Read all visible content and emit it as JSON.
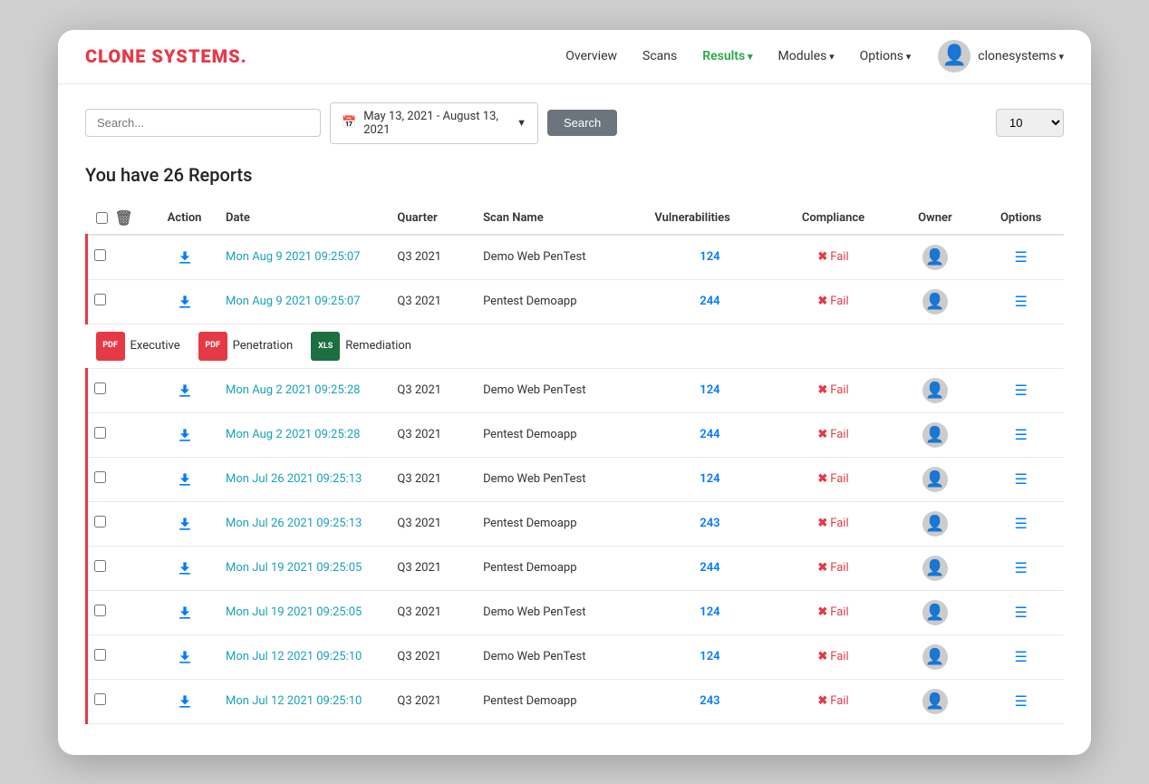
{
  "logo": {
    "text_before": "CLO",
    "highlight": "N",
    "text_after": "E SYSTEMS."
  },
  "nav": {
    "links": [
      {
        "label": "Overview",
        "active": false,
        "dropdown": false
      },
      {
        "label": "Scans",
        "active": false,
        "dropdown": false
      },
      {
        "label": "Results",
        "active": true,
        "dropdown": true
      },
      {
        "label": "Modules",
        "active": false,
        "dropdown": true
      },
      {
        "label": "Options",
        "active": false,
        "dropdown": true
      }
    ],
    "username": "clonesystems"
  },
  "search": {
    "placeholder": "Search...",
    "date_range": "May 13, 2021 - August 13, 2021",
    "search_btn": "Search",
    "per_page": "10"
  },
  "reports": {
    "count_text": "You have 26 Reports",
    "columns": [
      "Action",
      "Date",
      "Quarter",
      "Scan Name",
      "Vulnerabilities",
      "Compliance",
      "Owner",
      "Options"
    ]
  },
  "report_types": [
    {
      "type": "pdf",
      "label": "Executive"
    },
    {
      "type": "pdf",
      "label": "Penetration"
    },
    {
      "type": "xls",
      "label": "Remediation"
    }
  ],
  "rows": [
    {
      "id": 1,
      "date": "Mon Aug 9 2021 09:25:07",
      "quarter": "Q3 2021",
      "scan_name": "Demo Web PenTest",
      "vulnerabilities": 124,
      "compliance": "Fail",
      "show_report_types": false,
      "group": 1
    },
    {
      "id": 2,
      "date": "Mon Aug 9 2021 09:25:07",
      "quarter": "Q3 2021",
      "scan_name": "Pentest Demoapp",
      "vulnerabilities": 244,
      "compliance": "Fail",
      "show_report_types": true,
      "group": 1
    },
    {
      "id": 3,
      "date": "Mon Aug 2 2021 09:25:28",
      "quarter": "Q3 2021",
      "scan_name": "Demo Web PenTest",
      "vulnerabilities": 124,
      "compliance": "Fail",
      "show_report_types": false,
      "group": 2
    },
    {
      "id": 4,
      "date": "Mon Aug 2 2021 09:25:28",
      "quarter": "Q3 2021",
      "scan_name": "Pentest Demoapp",
      "vulnerabilities": 244,
      "compliance": "Fail",
      "show_report_types": false,
      "group": 2
    },
    {
      "id": 5,
      "date": "Mon Jul 26 2021 09:25:13",
      "quarter": "Q3 2021",
      "scan_name": "Demo Web PenTest",
      "vulnerabilities": 124,
      "compliance": "Fail",
      "show_report_types": false,
      "group": 3
    },
    {
      "id": 6,
      "date": "Mon Jul 26 2021 09:25:13",
      "quarter": "Q3 2021",
      "scan_name": "Pentest Demoapp",
      "vulnerabilities": 243,
      "compliance": "Fail",
      "show_report_types": false,
      "group": 3
    },
    {
      "id": 7,
      "date": "Mon Jul 19 2021 09:25:05",
      "quarter": "Q3 2021",
      "scan_name": "Pentest Demoapp",
      "vulnerabilities": 244,
      "compliance": "Fail",
      "show_report_types": false,
      "group": 4
    },
    {
      "id": 8,
      "date": "Mon Jul 19 2021 09:25:05",
      "quarter": "Q3 2021",
      "scan_name": "Demo Web PenTest",
      "vulnerabilities": 124,
      "compliance": "Fail",
      "show_report_types": false,
      "group": 4
    },
    {
      "id": 9,
      "date": "Mon Jul 12 2021 09:25:10",
      "quarter": "Q3 2021",
      "scan_name": "Demo Web PenTest",
      "vulnerabilities": 124,
      "compliance": "Fail",
      "show_report_types": false,
      "group": 5
    },
    {
      "id": 10,
      "date": "Mon Jul 12 2021 09:25:10",
      "quarter": "Q3 2021",
      "scan_name": "Pentest Demoapp",
      "vulnerabilities": 243,
      "compliance": "Fail",
      "show_report_types": false,
      "group": 5
    }
  ]
}
